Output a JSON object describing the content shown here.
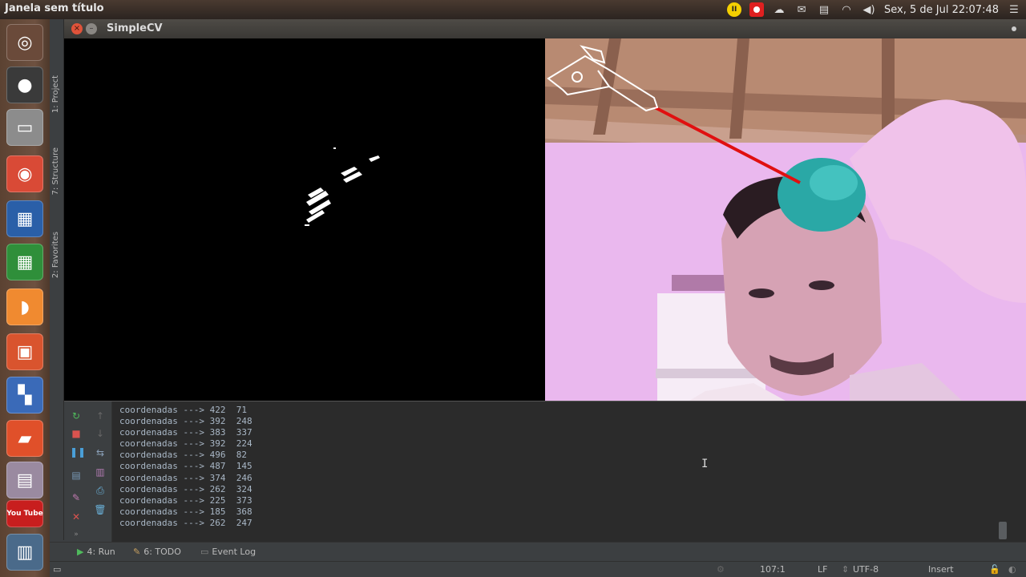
{
  "top_panel": {
    "title": "Janela sem título",
    "clock": "Sex, 5 de Jul 22:07:48"
  },
  "launcher": {
    "items": [
      "ubuntu-dash-icon",
      "media-icon",
      "files-icon",
      "chrome-icon",
      "writer-icon",
      "calc-icon",
      "orange-icon",
      "impress-icon",
      "apps-icon",
      "software-center-icon",
      "settings-icon",
      "youtube-icon",
      "workspace-icon"
    ],
    "youtube_label": "You Tube"
  },
  "ide": {
    "tabs": {
      "project": "1: Project",
      "structure": "7: Structure",
      "favorites": "2: Favorites"
    }
  },
  "cv_window": {
    "title": "SimpleCV"
  },
  "console": {
    "lines": [
      "coordenadas ---> 422  71",
      "coordenadas ---> 392  248",
      "coordenadas ---> 383  337",
      "coordenadas ---> 392  224",
      "coordenadas ---> 496  82",
      "coordenadas ---> 487  145",
      "coordenadas ---> 374  246",
      "coordenadas ---> 262  324",
      "coordenadas ---> 225  373",
      "coordenadas ---> 185  368",
      "coordenadas ---> 262  247"
    ]
  },
  "bottom_tabs": {
    "run": "4: Run",
    "todo": "6: TODO",
    "event_log": "Event Log"
  },
  "status": {
    "position": "107:1",
    "line_sep": "LF",
    "encoding": "UTF-8",
    "mode": "Insert"
  },
  "colors": {
    "ide_bg": "#3c3f41",
    "console_bg": "#2b2b2b",
    "laser": "#e01010"
  }
}
